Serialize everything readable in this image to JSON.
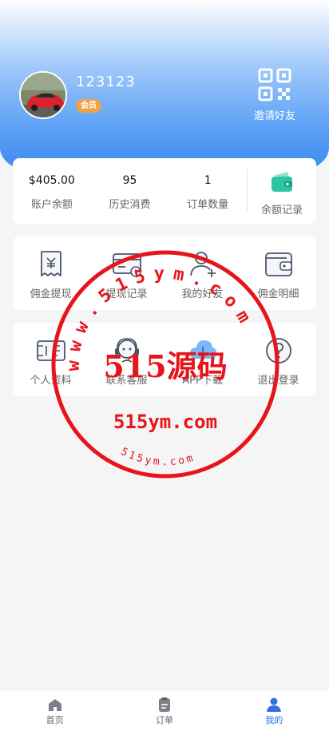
{
  "profile": {
    "username": "123123",
    "badge": "会员",
    "invite_label": "邀请好友"
  },
  "stats": [
    {
      "value": "$405.00",
      "label": "账户余额"
    },
    {
      "value": "95",
      "label": "历史消费"
    },
    {
      "value": "1",
      "label": "订单数量"
    }
  ],
  "balance_record": {
    "label": "余额记录",
    "icon": "wallet-icon"
  },
  "menu_row1": [
    {
      "label": "佣金提现",
      "icon": "commission-withdraw-icon"
    },
    {
      "label": "提现记录",
      "icon": "withdraw-record-icon"
    },
    {
      "label": "我的好友",
      "icon": "friends-icon"
    },
    {
      "label": "佣金明细",
      "icon": "commission-detail-icon"
    }
  ],
  "menu_row2": [
    {
      "label": "个人资料",
      "icon": "profile-icon"
    },
    {
      "label": "联系客服",
      "icon": "customer-service-icon"
    },
    {
      "label": "APP下载",
      "icon": "app-download-icon"
    },
    {
      "label": "退出登录",
      "icon": "logout-icon"
    }
  ],
  "tabbar": [
    {
      "label": "首页",
      "icon": "home-icon",
      "active": false
    },
    {
      "label": "订单",
      "icon": "orders-icon",
      "active": false
    },
    {
      "label": "我的",
      "icon": "user-icon",
      "active": true
    }
  ],
  "watermark": {
    "ring_text": "www.515ym.com",
    "center_text": "515源码",
    "url_text": "515ym.com",
    "bottom_text": "515ym.com",
    "color": "#e8141b"
  },
  "colors": {
    "accent": "#3f8af2",
    "tab_active": "#2f6fe0",
    "badge": "#f0a340"
  }
}
